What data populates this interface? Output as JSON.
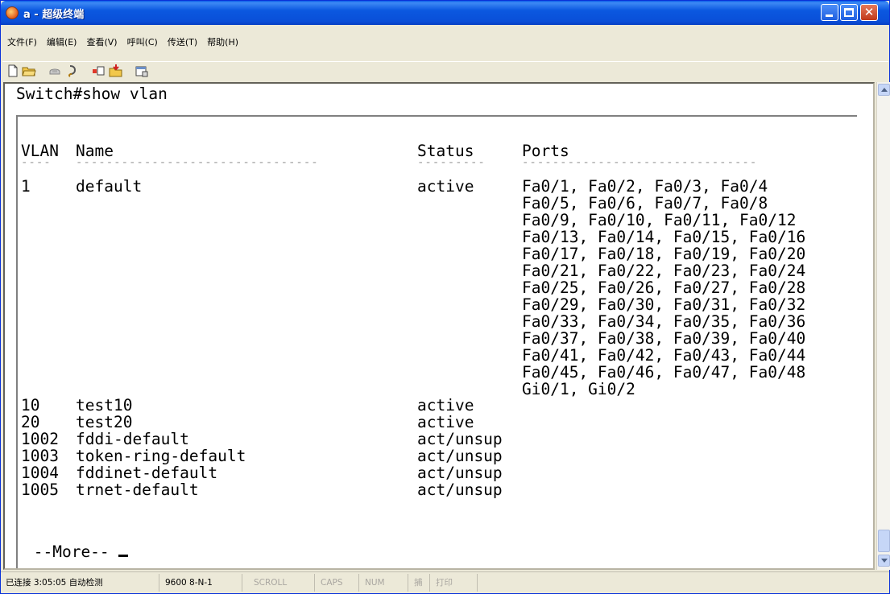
{
  "window": {
    "title": "a - 超级终端"
  },
  "menu": [
    "文件(F)",
    "编辑(E)",
    "查看(V)",
    "呼叫(C)",
    "传送(T)",
    "帮助(H)"
  ],
  "toolbar": {
    "icons": [
      "new-icon",
      "open-icon",
      "phone-icon",
      "disconnect-icon",
      "send-icon",
      "receive-icon",
      "properties-icon"
    ]
  },
  "terminal": {
    "command": "Switch#show vlan",
    "headers": {
      "vlan": "VLAN",
      "name": "Name",
      "status": "Status",
      "ports": "Ports"
    },
    "separators": {
      "vlan": "----",
      "name": "--------------------------------",
      "status": "---------",
      "ports": "-------------------------------"
    },
    "rows": [
      {
        "vlan": "1",
        "name": "default",
        "status": "active"
      },
      {
        "vlan": "10",
        "name": "test10",
        "status": "active"
      },
      {
        "vlan": "20",
        "name": "test20",
        "status": "active"
      },
      {
        "vlan": "1002",
        "name": "fddi-default",
        "status": "act/unsup"
      },
      {
        "vlan": "1003",
        "name": "token-ring-default",
        "status": "act/unsup"
      },
      {
        "vlan": "1004",
        "name": "fddinet-default",
        "status": "act/unsup"
      },
      {
        "vlan": "1005",
        "name": "trnet-default",
        "status": "act/unsup"
      }
    ],
    "default_ports": [
      "Fa0/1, Fa0/2, Fa0/3, Fa0/4",
      "Fa0/5, Fa0/6, Fa0/7, Fa0/8",
      "Fa0/9, Fa0/10, Fa0/11, Fa0/12",
      "Fa0/13, Fa0/14, Fa0/15, Fa0/16",
      "Fa0/17, Fa0/18, Fa0/19, Fa0/20",
      "Fa0/21, Fa0/22, Fa0/23, Fa0/24",
      "Fa0/25, Fa0/26, Fa0/27, Fa0/28",
      "Fa0/29, Fa0/30, Fa0/31, Fa0/32",
      "Fa0/33, Fa0/34, Fa0/35, Fa0/36",
      "Fa0/37, Fa0/38, Fa0/39, Fa0/40",
      "Fa0/41, Fa0/42, Fa0/43, Fa0/44",
      "Fa0/45, Fa0/46, Fa0/47, Fa0/48",
      "Gi0/1, Gi0/2"
    ],
    "more": " --More-- "
  },
  "statusbar": {
    "connection": "已连接 3:05:05 自动检测",
    "settings": "9600 8-N-1",
    "scroll": "SCROLL",
    "caps": "CAPS",
    "num": "NUM",
    "capture": "捕",
    "print": "打印"
  }
}
